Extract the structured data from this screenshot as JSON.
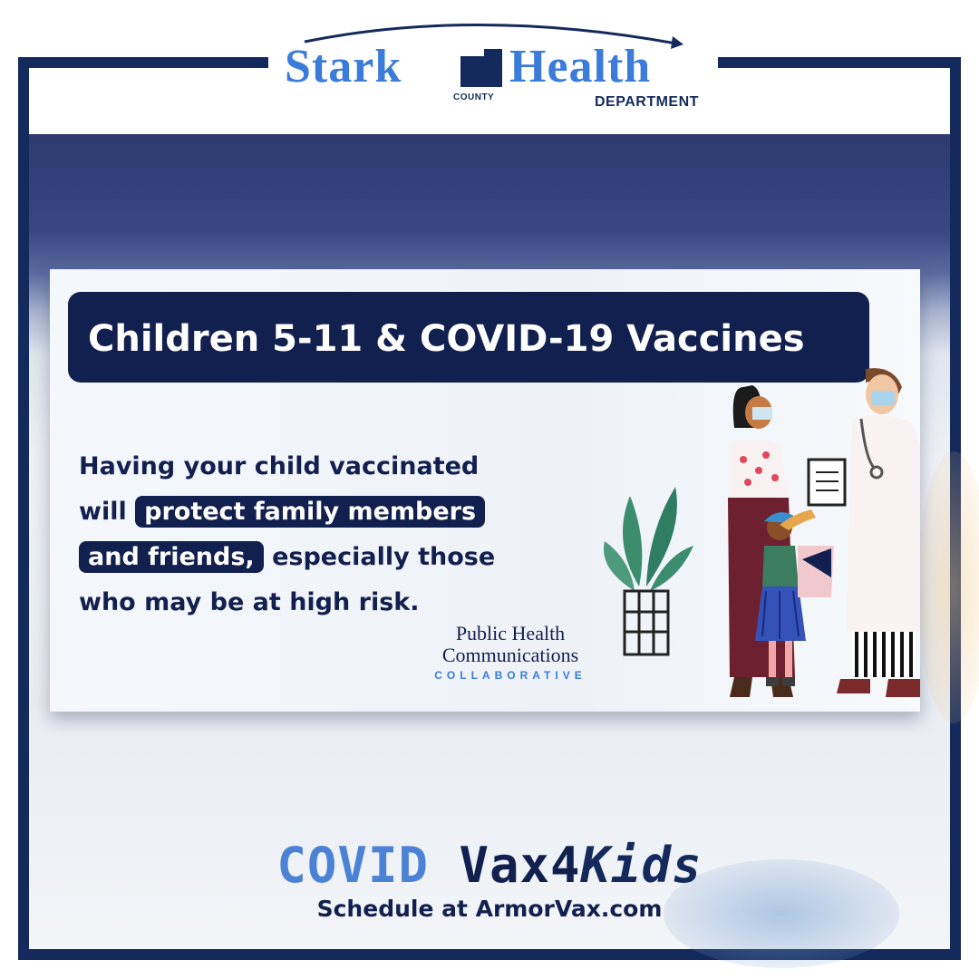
{
  "header": {
    "logo_word1": "Stark",
    "logo_word2": "Health",
    "logo_county": "COUNTY",
    "logo_department": "DEPARTMENT"
  },
  "card": {
    "title": "Children 5-11 & COVID-19 Vaccines",
    "body_line1": "Having your child vaccinated",
    "body_will": "will",
    "body_highlight1": "protect family members",
    "body_highlight2": "and friends,",
    "body_rest": "especially those",
    "body_line4": "who may be at high risk.",
    "credit_line1": "Public Health",
    "credit_line2": "Communications",
    "credit_line3": "COLLABORATIVE"
  },
  "footer": {
    "campaign_part1": "COVID",
    "campaign_part2": "Vax4",
    "campaign_part3": "Kids",
    "schedule": "Schedule at ArmorVax.com"
  },
  "colors": {
    "navy": "#12204f",
    "frame": "#142a5c",
    "brand_blue": "#3b7bd9"
  }
}
